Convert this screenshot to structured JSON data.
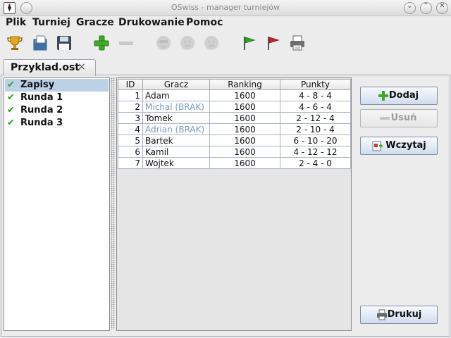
{
  "window": {
    "title": "OSwiss - manager turniejów",
    "controls": [
      "minimize",
      "maximize",
      "close"
    ]
  },
  "menu": [
    "Plik",
    "Turniej",
    "Gracze",
    "Drukowanie",
    "Pomoc"
  ],
  "toolbar": [
    {
      "name": "trophy-icon",
      "enabled": true
    },
    {
      "name": "open-file-icon",
      "enabled": true
    },
    {
      "name": "save-icon",
      "enabled": true
    },
    {
      "name": "add-icon",
      "enabled": true
    },
    {
      "name": "remove-icon",
      "enabled": false
    },
    {
      "name": "face-cool-icon",
      "enabled": false
    },
    {
      "name": "face-neutral-icon",
      "enabled": false
    },
    {
      "name": "face-sad-icon",
      "enabled": false
    },
    {
      "name": "green-flag-icon",
      "enabled": true
    },
    {
      "name": "red-flag-icon",
      "enabled": true
    },
    {
      "name": "printer-icon",
      "enabled": true
    }
  ],
  "tab": {
    "label": "Przyklad.ost",
    "close": "×"
  },
  "rounds": {
    "items": [
      {
        "label": "Zapisy",
        "selected": true
      },
      {
        "label": "Runda 1",
        "selected": false
      },
      {
        "label": "Runda 2",
        "selected": false
      },
      {
        "label": "Runda 3",
        "selected": false
      }
    ],
    "check_glyph": "✔"
  },
  "players_table": {
    "columns": [
      "ID",
      "Gracz",
      "Ranking",
      "Punkty"
    ],
    "rows": [
      {
        "id": "1",
        "name": "Adam",
        "ranking": "1600",
        "points": "4 - 8 - 4",
        "brak": false
      },
      {
        "id": "2",
        "name": "Michal (BRAK)",
        "ranking": "1600",
        "points": "4 - 6 - 4",
        "brak": true
      },
      {
        "id": "3",
        "name": "Tomek",
        "ranking": "1600",
        "points": "2 - 12 - 4",
        "brak": false
      },
      {
        "id": "4",
        "name": "Adrian (BRAK)",
        "ranking": "1600",
        "points": "2 - 10 - 4",
        "brak": true
      },
      {
        "id": "5",
        "name": "Bartek",
        "ranking": "1600",
        "points": "6 - 10 - 20",
        "brak": false
      },
      {
        "id": "6",
        "name": "Kamil",
        "ranking": "1600",
        "points": "4 - 12 - 12",
        "brak": false
      },
      {
        "id": "7",
        "name": "Wojtek",
        "ranking": "1600",
        "points": "2 - 4 - 0",
        "brak": false
      }
    ]
  },
  "buttons": {
    "add": "Dodaj",
    "remove": "Usuń",
    "load": "Wczytaj",
    "print": "Drukuj"
  },
  "colors": {
    "selection": "#bcd0e6",
    "check": "#3a9b28",
    "brak_text": "#7a9bc0",
    "button_border": "#7d8ea3"
  }
}
